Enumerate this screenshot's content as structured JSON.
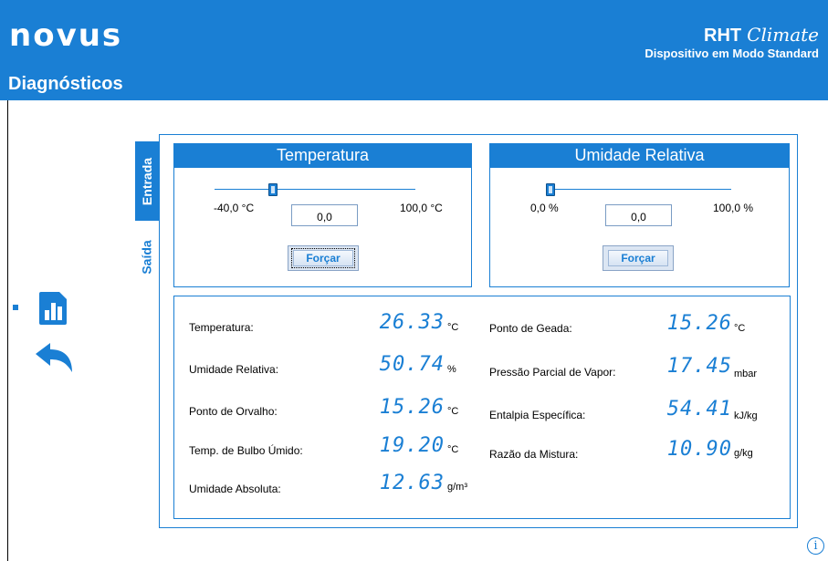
{
  "header": {
    "logo": "novus",
    "page_title": "Diagnósticos",
    "product_name": "RHT",
    "product_series": "Climate",
    "mode": "Dispositivo em Modo Standard"
  },
  "tabs": [
    {
      "label": "Entrada",
      "active": true
    },
    {
      "label": "Saída",
      "active": false
    }
  ],
  "inputs": {
    "temperature": {
      "title": "Temperatura",
      "min_label": "-40,0 °C",
      "max_label": "100,0 °C",
      "value": "0,0",
      "slider_fraction": 0.29,
      "button": "Forçar"
    },
    "humidity": {
      "title": "Umidade Relativa",
      "min_label": "0,0 %",
      "max_label": "100,0 %",
      "value": "0,0",
      "slider_fraction": 0.0,
      "button": "Forçar"
    }
  },
  "readings_left": [
    {
      "label": "Temperatura:",
      "value": "26.33",
      "unit": "°C"
    },
    {
      "label": "Umidade Relativa:",
      "value": "50.74",
      "unit": "%"
    },
    {
      "label": "Ponto de Orvalho:",
      "value": "15.26",
      "unit": "°C"
    },
    {
      "label": "Temp. de Bulbo Úmido:",
      "value": "19.20",
      "unit": "°C"
    },
    {
      "label": "Umidade Absoluta:",
      "value": "12.63",
      "unit": "g/m³"
    }
  ],
  "readings_right": [
    {
      "label": "Ponto de Geada:",
      "value": "15.26",
      "unit": "°C"
    },
    {
      "label": "Pressão Parcial de Vapor:",
      "value": "17.45",
      "unit": "mbar"
    },
    {
      "label": "Entalpia Específica:",
      "value": "54.41",
      "unit": "kJ/kg"
    },
    {
      "label": "Razão da Mistura:",
      "value": "10.90",
      "unit": "g/kg"
    }
  ],
  "icons": {
    "report": "report-chart-icon",
    "back": "back-arrow-icon",
    "info": "info-icon"
  },
  "colors": {
    "accent": "#1a7fd4",
    "background": "#ffffff"
  }
}
